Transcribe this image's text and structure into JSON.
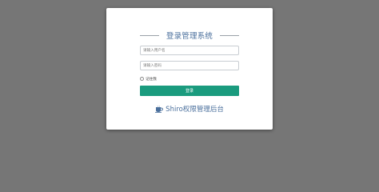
{
  "login": {
    "title": "登录管理系统",
    "username_placeholder": "请输入用户名",
    "password_placeholder": "请输入密码",
    "remember_label": "记住我",
    "submit_label": "登录",
    "brand_text": "Shiro权限管理后台",
    "brand_icon": "coffee-cup-icon"
  },
  "colors": {
    "page_background": "#767676",
    "card_background": "#ffffff",
    "accent": "#1a9b7e",
    "title_text": "#4a6f9c"
  }
}
